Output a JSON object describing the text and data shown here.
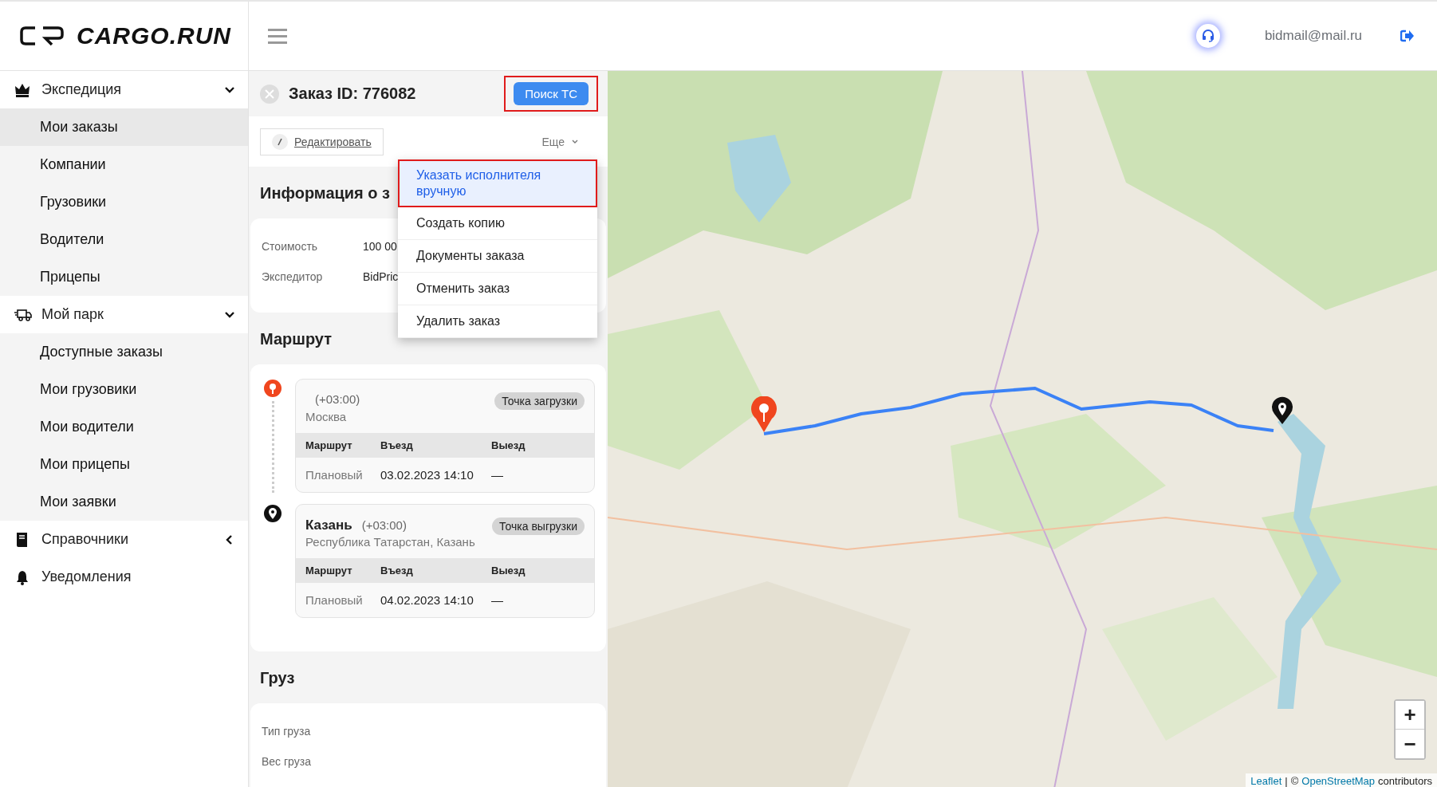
{
  "header": {
    "logo_text": "CARGO.RUN",
    "user_email": "bidmail@mail.ru"
  },
  "sidebar": {
    "groups": [
      {
        "label": "Экспедиция",
        "expanded": true,
        "items": [
          {
            "label": "Мои заказы",
            "selected": true
          },
          {
            "label": "Компании",
            "selected": false
          },
          {
            "label": "Грузовики",
            "selected": false
          },
          {
            "label": "Водители",
            "selected": false
          },
          {
            "label": "Прицепы",
            "selected": false
          }
        ]
      },
      {
        "label": "Мой парк",
        "expanded": true,
        "items": [
          {
            "label": "Доступные заказы",
            "selected": false
          },
          {
            "label": "Мои грузовики",
            "selected": false
          },
          {
            "label": "Мои водители",
            "selected": false
          },
          {
            "label": "Мои прицепы",
            "selected": false
          },
          {
            "label": "Мои заявки",
            "selected": false
          }
        ]
      },
      {
        "label": "Справочники",
        "expanded": false
      },
      {
        "label": "Уведомления"
      }
    ]
  },
  "order": {
    "title": "Заказ ID: 776082",
    "search_button": {
      "label": "Поиск ТС",
      "annotated": true
    },
    "edit_button": "Редактировать",
    "more_button": "Еще",
    "more_menu": [
      {
        "label": "Указать исполнителя вручную",
        "selected": true,
        "annotated": true
      },
      {
        "label": "Создать копию",
        "selected": false,
        "annotated": false
      },
      {
        "label": "Документы заказа",
        "selected": false,
        "annotated": false
      },
      {
        "label": "Отменить заказ",
        "selected": false,
        "annotated": false
      },
      {
        "label": "Удалить заказ",
        "selected": false,
        "annotated": false
      }
    ],
    "info": {
      "title": "Информация о з",
      "rows": [
        {
          "label": "Стоимость",
          "value": "100 00"
        },
        {
          "label": "Экспедитор",
          "value": "BidPric"
        }
      ]
    },
    "route": {
      "title": "Маршрут",
      "stops": [
        {
          "kind": "loading",
          "timezone": "(+03:00)",
          "address": "Москва",
          "badge": "Точка загрузки",
          "columns": [
            "Маршрут",
            "Въезд",
            "Выезд"
          ],
          "row": [
            "Плановый",
            "03.02.2023 14:10",
            "—"
          ]
        },
        {
          "kind": "unloading",
          "city": "Казань",
          "timezone": "(+03:00)",
          "address": "Республика Татарстан, Казань",
          "badge": "Точка выгрузки",
          "columns": [
            "Маршрут",
            "Въезд",
            "Выезд"
          ],
          "row": [
            "Плановый",
            "04.02.2023 14:10",
            "—"
          ]
        }
      ]
    },
    "cargo": {
      "title": "Груз",
      "rows": [
        "Тип груза",
        "Вес груза"
      ]
    }
  },
  "map": {
    "kind": "picture",
    "zoom_in": "+",
    "zoom_out": "−",
    "attribution": [
      {
        "kind": "link",
        "text": "Leaflet"
      },
      {
        "kind": "text",
        "text": "|"
      },
      {
        "kind": "text",
        "text": "©"
      },
      {
        "kind": "link",
        "text": "OpenStreetMap"
      },
      {
        "kind": "text",
        "text": "contributors"
      }
    ]
  }
}
